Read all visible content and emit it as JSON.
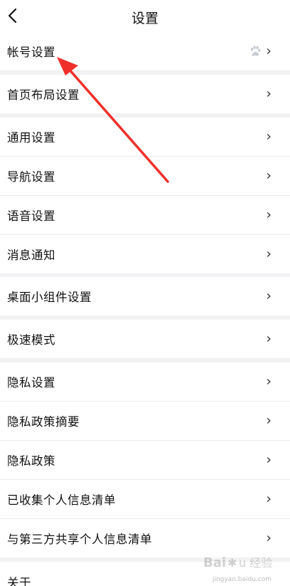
{
  "header": {
    "title": "设置"
  },
  "sections": [
    [
      {
        "label": "帐号设置",
        "icon": "paw-icon"
      }
    ],
    [
      {
        "label": "首页布局设置"
      }
    ],
    [
      {
        "label": "通用设置"
      },
      {
        "label": "导航设置"
      },
      {
        "label": "语音设置"
      },
      {
        "label": "消息通知"
      }
    ],
    [
      {
        "label": "桌面小组件设置"
      }
    ],
    [
      {
        "label": "极速模式"
      }
    ],
    [
      {
        "label": "隐私设置"
      },
      {
        "label": "隐私政策摘要"
      },
      {
        "label": "隐私政策"
      },
      {
        "label": "已收集个人信息清单"
      },
      {
        "label": "与第三方共享个人信息清单"
      }
    ],
    [
      {
        "label": "关于"
      }
    ]
  ],
  "chevron": "›",
  "watermark": {
    "text": "Baidu 经验",
    "url": "jingyan.baidu.com"
  },
  "colors": {
    "annotation_arrow": "#f0302b",
    "page_bg": "#f2f2f4"
  }
}
